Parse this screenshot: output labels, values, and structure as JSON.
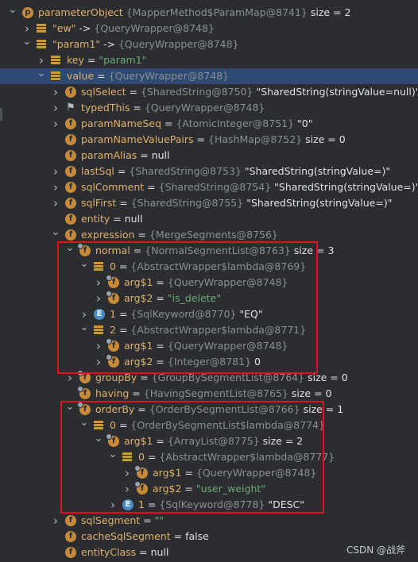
{
  "rows": [
    {
      "depth": 0,
      "arrow": "down",
      "icon": "p",
      "name": "parameterObject",
      "ref": "{MapperMethod$ParamMap@8741}",
      "extra": "size = 2"
    },
    {
      "depth": 1,
      "arrow": "right",
      "icon": "array",
      "name": "\"ew\"",
      "op": "->",
      "ref": "{QueryWrapper@8748}"
    },
    {
      "depth": 1,
      "arrow": "down",
      "icon": "array",
      "name": "\"param1\"",
      "op": "->",
      "ref": "{QueryWrapper@8748}"
    },
    {
      "depth": 2,
      "arrow": "right",
      "icon": "array",
      "name": "key",
      "op": "=",
      "strval": "\"param1\""
    },
    {
      "depth": 2,
      "arrow": "down",
      "icon": "array",
      "name": "value",
      "op": "=",
      "ref": "{QueryWrapper@8748}",
      "selected": true
    },
    {
      "depth": 3,
      "arrow": "right",
      "icon": "f",
      "name": "sqlSelect",
      "op": "=",
      "ref": "{SharedString@8750}",
      "val": "\"SharedString(stringValue=null)\""
    },
    {
      "depth": 3,
      "arrow": "right",
      "icon": "flag",
      "name": "typedThis",
      "op": "=",
      "ref": "{QueryWrapper@8748}"
    },
    {
      "depth": 3,
      "arrow": "right",
      "icon": "f",
      "name": "paramNameSeq",
      "op": "=",
      "ref": "{AtomicInteger@8751}",
      "val": "\"0\""
    },
    {
      "depth": 3,
      "arrow": "",
      "icon": "f",
      "name": "paramNameValuePairs",
      "op": "=",
      "ref": "{HashMap@8752}",
      "extra": "size = 0"
    },
    {
      "depth": 3,
      "arrow": "",
      "icon": "f",
      "name": "paramAlias",
      "op": "=",
      "val": "null"
    },
    {
      "depth": 3,
      "arrow": "right",
      "icon": "f",
      "name": "lastSql",
      "op": "=",
      "ref": "{SharedString@8753}",
      "val": "\"SharedString(stringValue=)\""
    },
    {
      "depth": 3,
      "arrow": "right",
      "icon": "f",
      "name": "sqlComment",
      "op": "=",
      "ref": "{SharedString@8754}",
      "val": "\"SharedString(stringValue=)\""
    },
    {
      "depth": 3,
      "arrow": "right",
      "icon": "f",
      "name": "sqlFirst",
      "op": "=",
      "ref": "{SharedString@8755}",
      "val": "\"SharedString(stringValue=)\""
    },
    {
      "depth": 3,
      "arrow": "",
      "icon": "f",
      "name": "entity",
      "op": "=",
      "val": "null"
    },
    {
      "depth": 3,
      "arrow": "down",
      "icon": "f",
      "name": "expression",
      "op": "=",
      "ref": "{MergeSegments@8756}"
    },
    {
      "depth": 4,
      "arrow": "down",
      "icon": "fb",
      "name": "normal",
      "op": "=",
      "ref": "{NormalSegmentList@8763}",
      "extra": "size = 3"
    },
    {
      "depth": 5,
      "arrow": "down",
      "icon": "array",
      "name": "0",
      "op": "=",
      "ref": "{AbstractWrapper$lambda@8769}"
    },
    {
      "depth": 6,
      "arrow": "right",
      "icon": "fb",
      "name": "arg$1",
      "op": "=",
      "ref": "{QueryWrapper@8748}"
    },
    {
      "depth": 6,
      "arrow": "right",
      "icon": "fb",
      "name": "arg$2",
      "op": "=",
      "strval": "\"is_delete\""
    },
    {
      "depth": 5,
      "arrow": "right",
      "icon": "e",
      "name": "1",
      "op": "=",
      "ref": "{SqlKeyword@8770}",
      "val": "\"EQ\""
    },
    {
      "depth": 5,
      "arrow": "down",
      "icon": "array",
      "name": "2",
      "op": "=",
      "ref": "{AbstractWrapper$lambda@8771}"
    },
    {
      "depth": 6,
      "arrow": "right",
      "icon": "fb",
      "name": "arg$1",
      "op": "=",
      "ref": "{QueryWrapper@8748}"
    },
    {
      "depth": 6,
      "arrow": "right",
      "icon": "fb",
      "name": "arg$2",
      "op": "=",
      "ref": "{Integer@8781}",
      "val": "0"
    },
    {
      "depth": 4,
      "arrow": "right",
      "icon": "fb",
      "name": "groupBy",
      "op": "=",
      "ref": "{GroupBySegmentList@8764}",
      "extra": "size = 0"
    },
    {
      "depth": 4,
      "arrow": "",
      "icon": "fb",
      "name": "having",
      "op": "=",
      "ref": "{HavingSegmentList@8765}",
      "extra": "size = 0"
    },
    {
      "depth": 4,
      "arrow": "down",
      "icon": "fb",
      "name": "orderBy",
      "op": "=",
      "ref": "{OrderBySegmentList@8766}",
      "extra": "size = 1"
    },
    {
      "depth": 5,
      "arrow": "down",
      "icon": "array",
      "name": "0",
      "op": "=",
      "ref": "{OrderBySegmentList$lambda@8774}"
    },
    {
      "depth": 6,
      "arrow": "down",
      "icon": "fb",
      "name": "arg$1",
      "op": "=",
      "ref": "{ArrayList@8775}",
      "extra": "size = 2"
    },
    {
      "depth": 7,
      "arrow": "down",
      "icon": "array",
      "name": "0",
      "op": "=",
      "ref": "{AbstractWrapper$lambda@8777}"
    },
    {
      "depth": 8,
      "arrow": "right",
      "icon": "fb",
      "name": "arg$1",
      "op": "=",
      "ref": "{QueryWrapper@8748}"
    },
    {
      "depth": 8,
      "arrow": "right",
      "icon": "fb",
      "name": "arg$2",
      "op": "=",
      "strval": "\"user_weight\""
    },
    {
      "depth": 7,
      "arrow": "right",
      "icon": "e",
      "name": "1",
      "op": "=",
      "ref": "{SqlKeyword@8778}",
      "val": "\"DESC\""
    },
    {
      "depth": 3,
      "arrow": "right",
      "icon": "f",
      "name": "sqlSegment",
      "op": "=",
      "strval": "\"\""
    },
    {
      "depth": 3,
      "arrow": "",
      "icon": "f",
      "name": "cacheSqlSegment",
      "op": "=",
      "val": "false"
    },
    {
      "depth": 3,
      "arrow": "",
      "icon": "f",
      "name": "entityClass",
      "op": "=",
      "val": "null"
    }
  ],
  "watermark": "CSDN @战斧",
  "colors": {
    "highlight": "#e0121d",
    "selected_row": "#2d4a73",
    "field_name": "#dfb06a",
    "string": "#6aab73",
    "ref": "#8b8e94"
  }
}
